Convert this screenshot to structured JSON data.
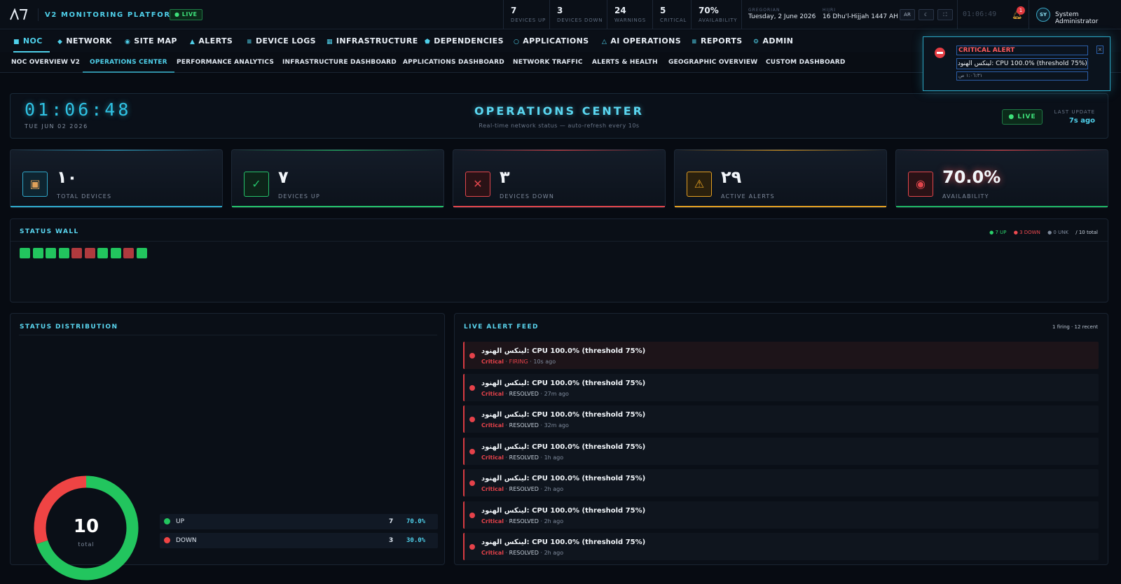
{
  "topbar": {
    "brand": "V2 MONITORING PLATFORM",
    "live": "● LIVE",
    "stats": [
      {
        "value": "7",
        "label": "Devices Up"
      },
      {
        "value": "3",
        "label": "Devices Down"
      },
      {
        "value": "24",
        "label": "Warnings"
      },
      {
        "value": "5",
        "label": "Critical"
      },
      {
        "value": "70%",
        "label": "Availability"
      }
    ],
    "gregorian_label": "GREGORIAN",
    "gregorian_date": "Tuesday, 2 June 2026",
    "hijri_label": "HIJRI",
    "hijri_date": "16 Dhu'l-Hijjah 1447 AH",
    "lang_button": "AR",
    "theme_icon": "moon-icon",
    "fullscreen_icon": "fullscreen-icon",
    "clock": "01:06:49",
    "bell_icon": "bell-icon",
    "notification_count": "1",
    "avatar_initials": "SY",
    "user_name": "System Administrator"
  },
  "main_nav": [
    {
      "icon": "■",
      "label": "NOC"
    },
    {
      "icon": "◆",
      "label": "NETWORK"
    },
    {
      "icon": "◉",
      "label": "SITE MAP"
    },
    {
      "icon": "▲",
      "label": "ALERTS"
    },
    {
      "icon": "≡",
      "label": "DEVICE LOGS"
    },
    {
      "icon": "▦",
      "label": "INFRASTRUCTURE"
    },
    {
      "icon": "⬟",
      "label": "DEPENDENCIES"
    },
    {
      "icon": "○",
      "label": "APPLICATIONS"
    },
    {
      "icon": "△",
      "label": "AI OPERATIONS"
    },
    {
      "icon": "≡",
      "label": "REPORTS"
    },
    {
      "icon": "⚙",
      "label": "ADMIN"
    }
  ],
  "sub_nav": [
    "NOC OVERVIEW V2",
    "OPERATIONS CENTER",
    "PERFORMANCE ANALYTICS",
    "INFRASTRUCTURE DASHBOARD",
    "APPLICATIONS DASHBOARD",
    "NETWORK TRAFFIC",
    "ALERTS & HEALTH",
    "GEOGRAPHIC OVERVIEW",
    "CUSTOM DASHBOARD"
  ],
  "toast": {
    "title": "CRITICAL ALERT",
    "message": "لينكس الهنود: CPU 100.0% (threshold 75%)",
    "time": "١:٠٦:٣١ ص",
    "close": "×"
  },
  "ops_header": {
    "clock": "01:06:48",
    "date": "TUE JUN 02 2026",
    "title": "OPERATIONS CENTER",
    "subtitle": "Real-time network status — auto-refresh every 10s",
    "live": "● LIVE",
    "last_update_label": "LAST UPDATE",
    "last_update_value": "7s ago"
  },
  "kpis": [
    {
      "icon": "box-icon",
      "value": "١٠",
      "label": "TOTAL DEVICES",
      "color": "#2fa7c9"
    },
    {
      "icon": "check-icon",
      "value": "٧",
      "label": "DEVICES UP",
      "color": "#25c16a"
    },
    {
      "icon": "x-icon",
      "value": "٣",
      "label": "DEVICES DOWN",
      "color": "#e0464c"
    },
    {
      "icon": "warning-icon",
      "value": "٢٩",
      "label": "ACTIVE ALERTS",
      "color": "#e4a022"
    },
    {
      "icon": "target-icon",
      "value": "70.0%",
      "label": "AVAILABILITY",
      "color": "#1fb463"
    }
  ],
  "status_wall": {
    "title": "STATUS WALL",
    "legend_up": "● 7 UP",
    "legend_down": "● 3 DOWN",
    "legend_unk": "● 0 UNK",
    "legend_total": "/ 10 total",
    "tiles": [
      "up",
      "up",
      "up",
      "up",
      "down",
      "down",
      "up",
      "up",
      "down",
      "up"
    ]
  },
  "distribution": {
    "title": "STATUS DISTRIBUTION",
    "total": "10",
    "total_label": "total",
    "rows": [
      {
        "name": "UP",
        "count": "7",
        "pct": "70.0%",
        "color": "#22c55e"
      },
      {
        "name": "DOWN",
        "count": "3",
        "pct": "30.0%",
        "color": "#ef4444"
      }
    ],
    "chart_data": {
      "type": "pie",
      "categories": [
        "UP",
        "DOWN"
      ],
      "values": [
        7,
        3
      ]
    }
  },
  "alert_feed": {
    "title": "LIVE ALERT FEED",
    "meta": "1 firing · 12 recent",
    "items": [
      {
        "message": "لينكس الهنود: CPU 100.0% (threshold 75%)",
        "severity": "Critical",
        "status": "FIRING",
        "time": "10s ago"
      },
      {
        "message": "لينكس الهنود: CPU 100.0% (threshold 75%)",
        "severity": "Critical",
        "status": "RESOLVED",
        "time": "27m ago"
      },
      {
        "message": "لينكس الهنود: CPU 100.0% (threshold 75%)",
        "severity": "Critical",
        "status": "RESOLVED",
        "time": "32m ago"
      },
      {
        "message": "لينكس الهنود: CPU 100.0% (threshold 75%)",
        "severity": "Critical",
        "status": "RESOLVED",
        "time": "1h ago"
      },
      {
        "message": "لينكس الهنود: CPU 100.0% (threshold 75%)",
        "severity": "Critical",
        "status": "RESOLVED",
        "time": "2h ago"
      },
      {
        "message": "لينكس الهنود: CPU 100.0% (threshold 75%)",
        "severity": "Critical",
        "status": "RESOLVED",
        "time": "2h ago"
      },
      {
        "message": "لينكس الهنود: CPU 100.0% (threshold 75%)",
        "severity": "Critical",
        "status": "RESOLVED",
        "time": "2h ago"
      }
    ]
  }
}
